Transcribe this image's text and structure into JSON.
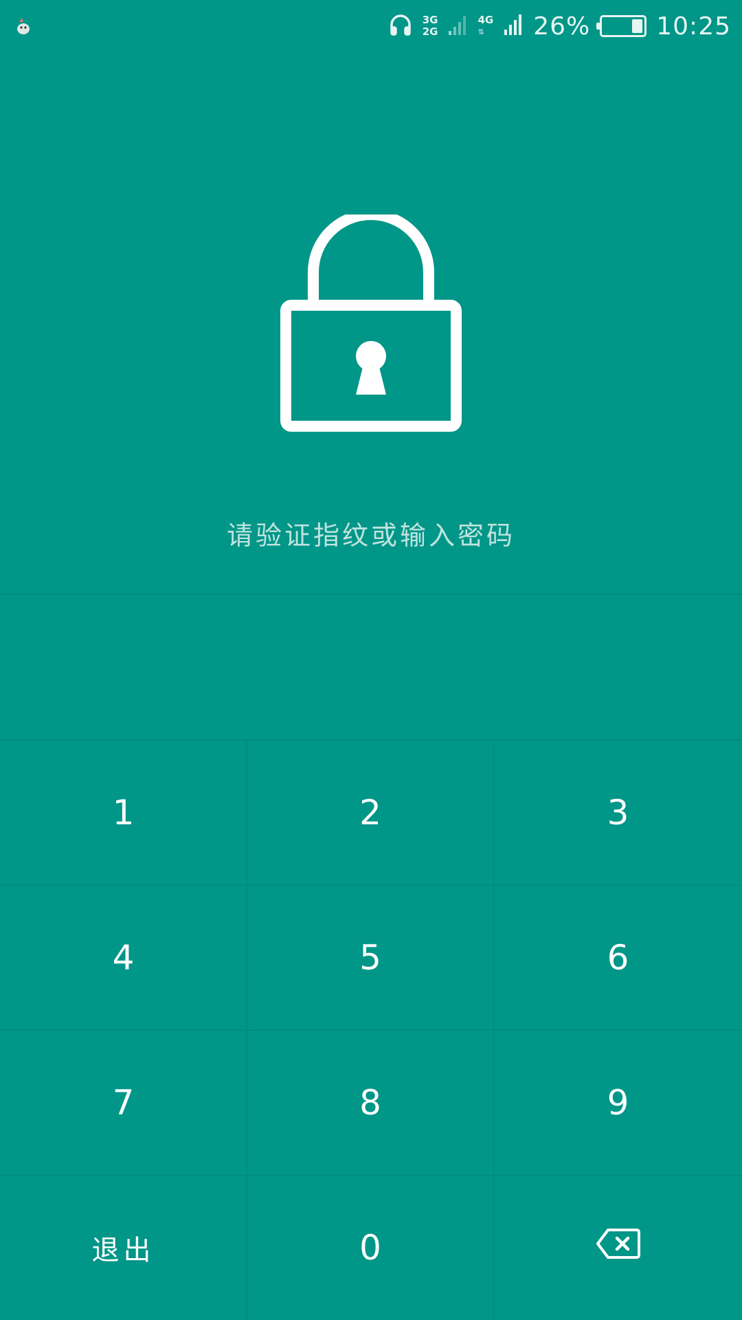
{
  "status_bar": {
    "app_icon": "android-robot-icon",
    "headset_icon": "headset-icon",
    "sim1_labels": [
      "3G",
      "2G"
    ],
    "sim2_label": "4G",
    "battery_percent": "26%",
    "battery_level": 0.26,
    "time": "10:25"
  },
  "lock": {
    "icon": "padlock-icon",
    "prompt": "请验证指纹或输入密码"
  },
  "keypad": {
    "keys": [
      {
        "label": "1"
      },
      {
        "label": "2"
      },
      {
        "label": "3"
      },
      {
        "label": "4"
      },
      {
        "label": "5"
      },
      {
        "label": "6"
      },
      {
        "label": "7"
      },
      {
        "label": "8"
      },
      {
        "label": "9"
      },
      {
        "label": "退出"
      },
      {
        "label": "0"
      },
      {
        "icon": "backspace-icon"
      }
    ]
  },
  "colors": {
    "background": "#009688",
    "text": "#ffffff",
    "prompt_text": "#bfe3de"
  }
}
